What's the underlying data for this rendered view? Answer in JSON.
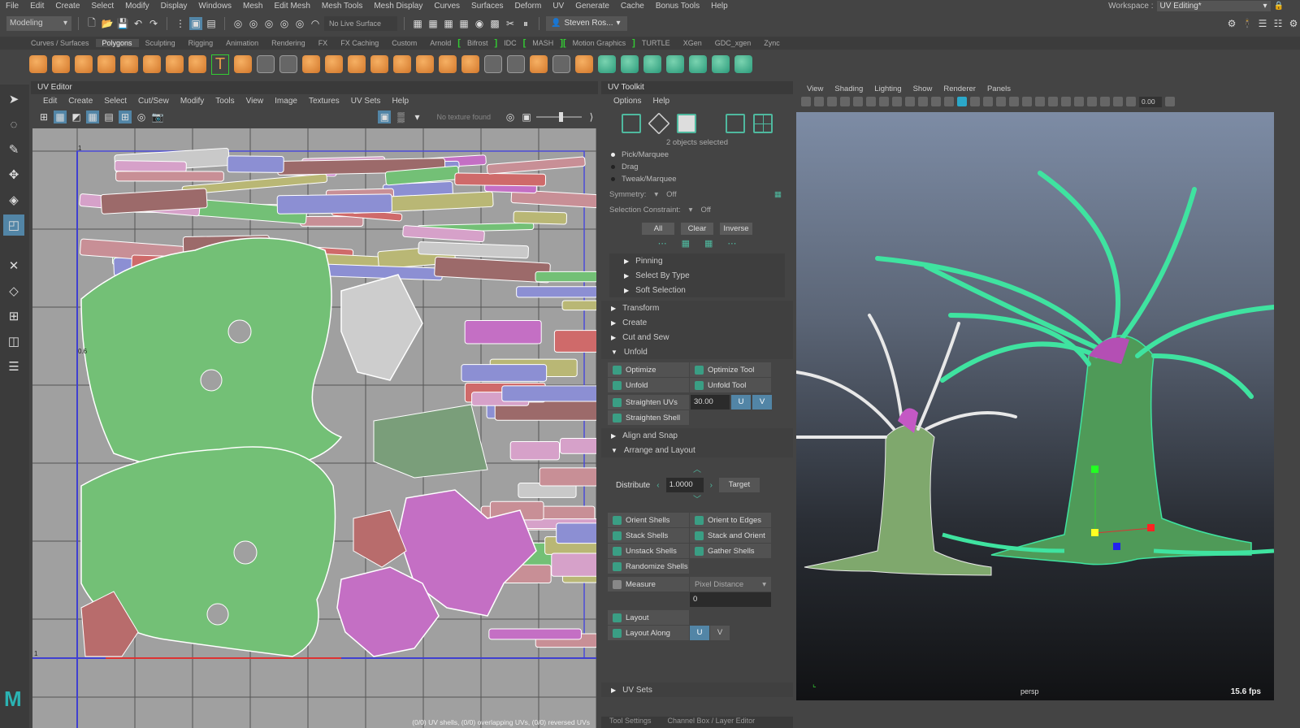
{
  "menubar": {
    "items": [
      "File",
      "Edit",
      "Create",
      "Select",
      "Modify",
      "Display",
      "Windows",
      "Mesh",
      "Edit Mesh",
      "Mesh Tools",
      "Mesh Display",
      "Curves",
      "Surfaces",
      "Deform",
      "UV",
      "Generate",
      "Cache",
      "Bonus Tools",
      "Help"
    ],
    "workspace_label": "Workspace :",
    "workspace_value": "UV Editing*"
  },
  "statusline": {
    "mode": "Modeling",
    "live_surface": "No Live Surface",
    "user": "Steven Ros..."
  },
  "shelf_tabs": [
    "Curves / Surfaces",
    "Polygons",
    "Sculpting",
    "Rigging",
    "Animation",
    "Rendering",
    "FX",
    "FX Caching",
    "Custom",
    "Arnold",
    "Bifrost",
    "IDC",
    "MASH",
    "Motion Graphics",
    "TURTLE",
    "XGen",
    "GDC_xgen",
    "Zync"
  ],
  "shelf_active_tab": "Polygons",
  "uv_editor": {
    "title": "UV Editor",
    "menu": [
      "Edit",
      "Create",
      "Select",
      "Cut/Sew",
      "Modify",
      "Tools",
      "View",
      "Image",
      "Textures",
      "UV Sets",
      "Help"
    ],
    "texture_status": "No texture found",
    "axis_labels": {
      "top": "1",
      "mid": "0.6",
      "bottom": "1"
    },
    "info": "(0/0) UV shells, (0/0) overlapping UVs, (0/0) reversed UVs"
  },
  "uv_toolkit": {
    "title": "UV Toolkit",
    "menu": [
      "Options",
      "Help"
    ],
    "selection_status": "2 objects selected",
    "modes": [
      {
        "label": "Pick/Marquee",
        "selected": true
      },
      {
        "label": "Drag",
        "selected": false
      },
      {
        "label": "Tweak/Marquee",
        "selected": false
      }
    ],
    "symmetry_label": "Symmetry:",
    "symmetry_value": "Off",
    "constraint_label": "Selection Constraint:",
    "constraint_value": "Off",
    "buttons": [
      "All",
      "Clear",
      "Inverse"
    ],
    "subsections": [
      "Pinning",
      "Select By Type",
      "Soft Selection"
    ],
    "sections_collapsed": [
      "Transform",
      "Create",
      "Cut and Sew"
    ],
    "unfold": {
      "title": "Unfold",
      "optimize": "Optimize",
      "optimize_tool": "Optimize Tool",
      "unfold": "Unfold",
      "unfold_tool": "Unfold Tool",
      "straighten_uvs": "Straighten UVs",
      "straighten_value": "30.00",
      "u": "U",
      "v": "V",
      "straighten_shell": "Straighten Shell"
    },
    "align_snap": "Align and Snap",
    "arrange": {
      "title": "Arrange and Layout",
      "distribute_label": "Distribute",
      "distribute_value": "1.0000",
      "target": "Target",
      "orient_shells": "Orient Shells",
      "orient_edges": "Orient to Edges",
      "stack_shells": "Stack Shells",
      "stack_orient": "Stack and Orient",
      "unstack_shells": "Unstack Shells",
      "gather_shells": "Gather Shells",
      "randomize_shells": "Randomize Shells",
      "measure": "Measure",
      "measure_mode": "Pixel Distance",
      "measure_value": "0",
      "layout": "Layout",
      "layout_along": "Layout Along",
      "u": "U",
      "v": "V"
    },
    "uv_sets": "UV Sets",
    "bottom_tabs": [
      "Tool Settings",
      "Channel Box / Layer Editor"
    ]
  },
  "viewport": {
    "menu": [
      "View",
      "Shading",
      "Lighting",
      "Show",
      "Renderer",
      "Panels"
    ],
    "field_value": "0.00",
    "camera": "persp",
    "fps": "15.6 fps"
  }
}
